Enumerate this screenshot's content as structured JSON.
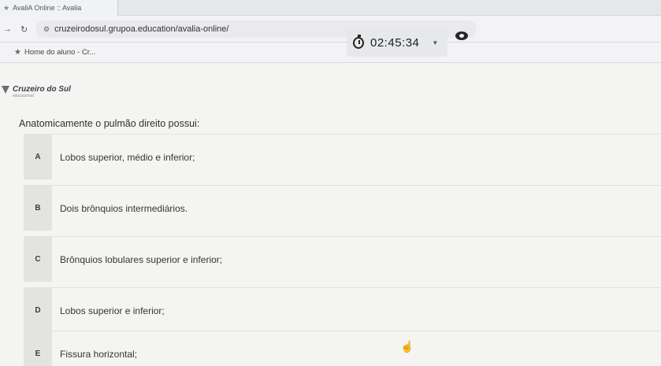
{
  "browser": {
    "tab_title": "AvaliA Online :: Avalia",
    "url": "cruzeirodosul.grupoa.education/avalia-online/",
    "bookmark_label": "Home do aluno - Cr..."
  },
  "timer": {
    "value": "02:45:34"
  },
  "logo": {
    "name": "Cruzeiro do Sul",
    "sub": "educacional"
  },
  "question": {
    "text": "Anatomicamente o pulmão direito possui:",
    "options": [
      {
        "letter": "A",
        "text": "Lobos superior, médio e inferior;"
      },
      {
        "letter": "B",
        "text": "Dois brônquios intermediários."
      },
      {
        "letter": "C",
        "text": "Brônquios lobulares superior e inferior;"
      },
      {
        "letter": "D",
        "text": "Lobos superior e inferior;"
      },
      {
        "letter": "E",
        "text": "Fissura horizontal;"
      }
    ]
  }
}
